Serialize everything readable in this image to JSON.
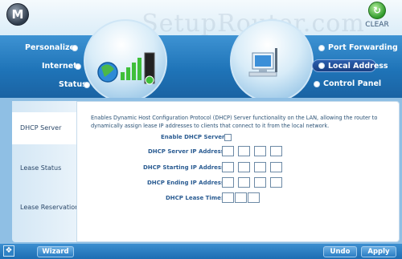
{
  "brand": {
    "logo_glyph": "M",
    "watermark": "SetupRouter.com"
  },
  "header": {
    "clear_label": "CLEAR",
    "clear_icon": "refresh-icon"
  },
  "nav_left": [
    {
      "label": "Personalize"
    },
    {
      "label": "Internet"
    },
    {
      "label": "Status"
    }
  ],
  "nav_right": [
    {
      "label": "Port Forwarding"
    },
    {
      "label": "Local Address",
      "active": true
    },
    {
      "label": "Control Panel"
    }
  ],
  "sidebar": {
    "items": [
      {
        "label": "DHCP Server",
        "active": true
      },
      {
        "label": "Lease Status"
      },
      {
        "label": "Lease Reservation"
      }
    ]
  },
  "main": {
    "description": "Enables Dynamic Host Configuration Protocol (DHCP) Server functionality on the LAN, allowing the router to dynamically assign lease IP addresses to clients that connect to it from the local network.",
    "enable_label": "Enable DHCP Server",
    "server_ip_label": "DHCP Server IP Address:",
    "start_ip_label": "DHCP Starting IP Address:",
    "end_ip_label": "DHCP Ending IP Address:",
    "lease_time_label": "DHCP Lease Time:"
  },
  "footer": {
    "wizard_label": "Wizard",
    "undo_label": "Undo",
    "apply_label": "Apply"
  },
  "colors": {
    "accent": "#1f74b8",
    "active_nav": "#1a3f82"
  }
}
